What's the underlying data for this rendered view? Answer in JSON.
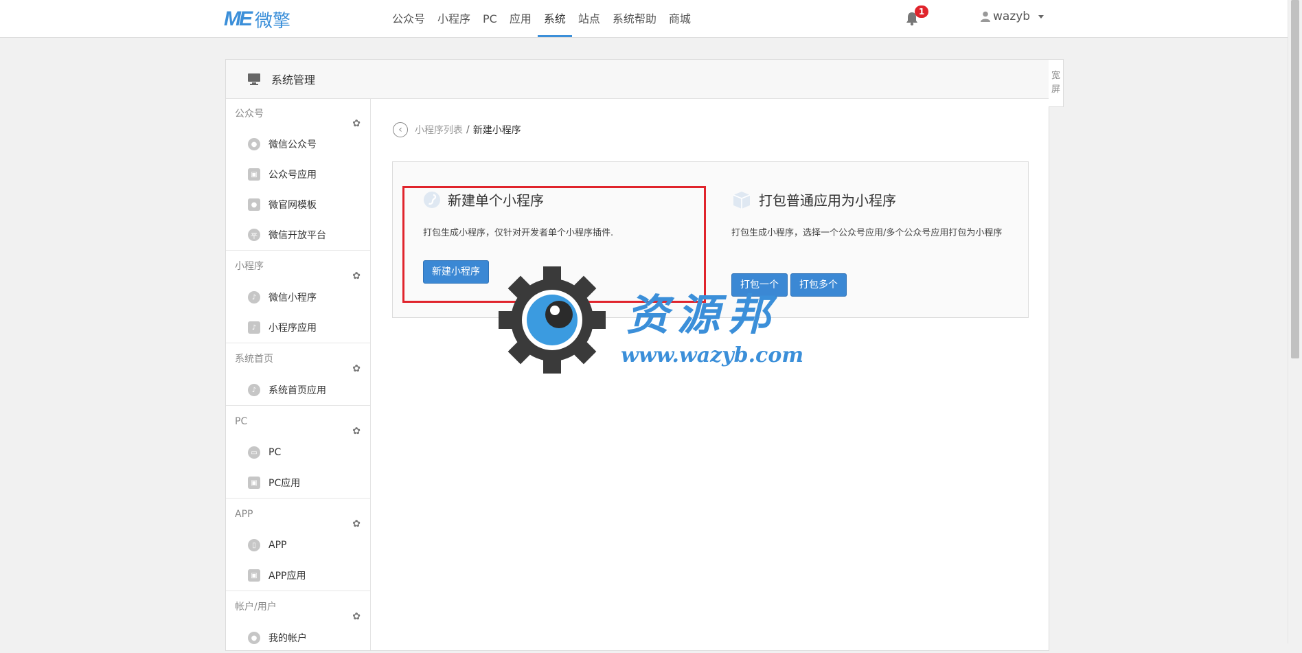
{
  "brand": {
    "mark": "ME",
    "text": "微擎"
  },
  "nav": {
    "items": [
      "公众号",
      "小程序",
      "PC",
      "应用",
      "系统",
      "站点",
      "系统帮助",
      "商城"
    ],
    "active_index": 4
  },
  "notifications": {
    "count": "1"
  },
  "user": {
    "name": "wazyb"
  },
  "panel": {
    "title": "系统管理",
    "widescreen": "宽屏"
  },
  "sidebar": {
    "groups": [
      {
        "title": "公众号",
        "items": [
          "微信公众号",
          "公众号应用",
          "微官网模板",
          "微信开放平台"
        ]
      },
      {
        "title": "小程序",
        "items": [
          "微信小程序",
          "小程序应用"
        ]
      },
      {
        "title": "系统首页",
        "items": [
          "系统首页应用"
        ]
      },
      {
        "title": "PC",
        "items": [
          "PC",
          "PC应用"
        ]
      },
      {
        "title": "APP",
        "items": [
          "APP",
          "APP应用"
        ]
      },
      {
        "title": "帐户/用户",
        "items": [
          "我的帐户"
        ]
      }
    ]
  },
  "breadcrumb": {
    "link": "小程序列表",
    "separator": "/",
    "current": "新建小程序"
  },
  "cards": {
    "single": {
      "title": "新建单个小程序",
      "desc": "打包生成小程序，仅针对开发者单个小程序插件.",
      "button": "新建小程序"
    },
    "package": {
      "title": "打包普通应用为小程序",
      "desc": "打包生成小程序，选择一个公众号应用/多个公众号应用打包为小程序",
      "button_one": "打包一个",
      "button_many": "打包多个"
    }
  },
  "watermark": {
    "name": "资源邦",
    "url": "www.wazyb.com"
  },
  "colors": {
    "accent": "#3b8fd9",
    "button": "#3b88d4",
    "highlight": "#e0242c"
  }
}
